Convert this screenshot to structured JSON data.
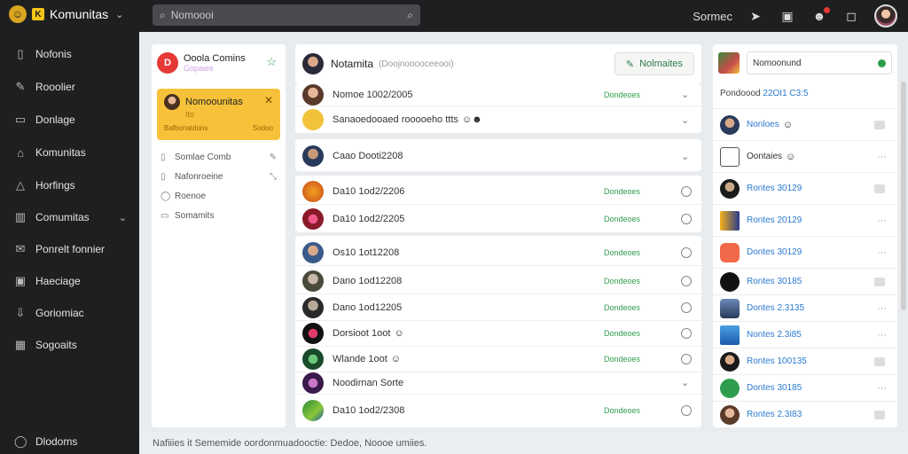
{
  "app": {
    "name": "Komunitas",
    "logo_letter": "K"
  },
  "search": {
    "placeholder": "Nomoooi"
  },
  "topbar": {
    "label": "Sormec"
  },
  "sidebar": {
    "items": [
      {
        "label": "Nofonis",
        "icon": "document-icon"
      },
      {
        "label": "Rooolier",
        "icon": "edit-icon"
      },
      {
        "label": "Donlage",
        "icon": "inbox-icon"
      },
      {
        "label": "Komunitas",
        "icon": "home-icon"
      },
      {
        "label": "Horfings",
        "icon": "home-outline-icon"
      },
      {
        "label": "Comumitas",
        "icon": "building-icon"
      },
      {
        "label": "Ponrelt fonnier",
        "icon": "mail-icon"
      },
      {
        "label": "Haeciage",
        "icon": "image-icon"
      },
      {
        "label": "Goriomiac",
        "icon": "download-icon"
      },
      {
        "label": "Sogoaits",
        "icon": "grid-icon"
      }
    ],
    "bottom": {
      "label": "Dlodoms",
      "icon": "user-icon"
    }
  },
  "left_panel": {
    "title": "Ooola Comins",
    "subtitle": "Gopaies",
    "card": {
      "title": "Nomoounitas",
      "subtitle": "Ito",
      "meta_left": "Bafbonatdons",
      "meta_right": "Sodoo"
    },
    "links": [
      {
        "label": "Somlae Comb"
      },
      {
        "label": "Nafonroeine"
      },
      {
        "label": "Roenoe"
      },
      {
        "label": "Somamits"
      }
    ]
  },
  "middle": {
    "header": {
      "title": "Notamita",
      "subtitle": "(Doojnooooceeooi)",
      "button": "Nolmaites"
    },
    "group1": [
      {
        "name": "Nomoe 1002/2005",
        "status": "Dondeoes"
      },
      {
        "name": "Sanaoedooaed rooooeho ttts",
        "status": ""
      }
    ],
    "group2": [
      {
        "name": "Caao Dooti2208"
      }
    ],
    "group3": [
      {
        "name": "Da10 1od2/2206",
        "status": "Dondeoes"
      },
      {
        "name": "Da10 1od2/2205",
        "status": "Dondeoes"
      }
    ],
    "group4": [
      {
        "name": "Os10 1ot12208",
        "status": "Dondeoes"
      },
      {
        "name": "Dano 1od12208",
        "status": "Dondeoes"
      },
      {
        "name": "Dano 1od12205",
        "status": "Dondeoes"
      },
      {
        "name": "Dorsioot 1oot",
        "status": "Dondeoes"
      },
      {
        "name": "Wlande 1oot",
        "status": "Dondeoes"
      },
      {
        "name": "Noodirnan Sorte",
        "status": ""
      },
      {
        "name": "Da10 1od2/2308",
        "status": "Dondeoes"
      }
    ]
  },
  "right_panel": {
    "input_value": "Nomoonund",
    "label_prefix": "Pondoood",
    "label_value": "22OI1 C3:5",
    "rows": [
      {
        "name": "Nonloes",
        "ctl": "square",
        "dark": false
      },
      {
        "name": "Oontaies",
        "ctl": "dots",
        "dark": true
      },
      {
        "name": "Rontes 30129",
        "ctl": "square",
        "dark": false
      },
      {
        "name": "Rontes 20129",
        "ctl": "dots",
        "dark": false
      },
      {
        "name": "Dontes 30129",
        "ctl": "dots",
        "dark": false
      },
      {
        "name": "Rontes 30185",
        "ctl": "square",
        "dark": false
      },
      {
        "name": "Dontes 2.3135",
        "ctl": "dots",
        "dark": false
      },
      {
        "name": "Nontes 2.3i85",
        "ctl": "dots",
        "dark": false
      },
      {
        "name": "Rontes 100135",
        "ctl": "square",
        "dark": false
      },
      {
        "name": "Dontes 30185",
        "ctl": "dots",
        "dark": false
      },
      {
        "name": "Rontes 2.3I83",
        "ctl": "square",
        "dark": false
      }
    ]
  },
  "footer": {
    "text": "Nafiiies it Sememide oordonmuadooctie: Dedoe, Noooe umiies."
  }
}
